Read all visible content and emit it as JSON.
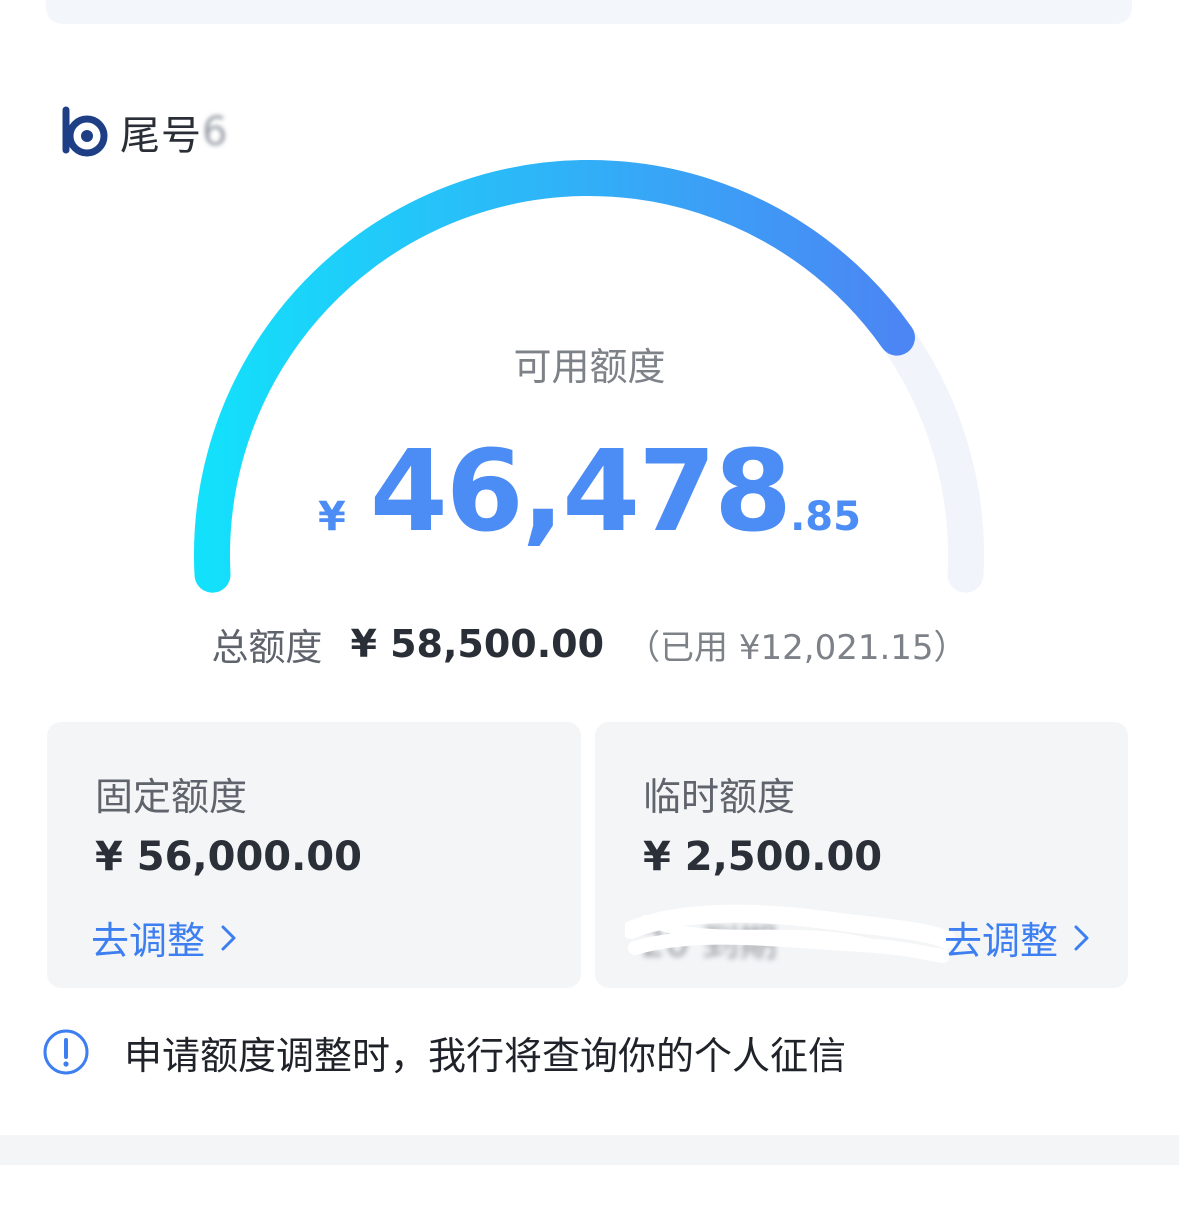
{
  "card": {
    "label": "尾号",
    "tail_visible": "6",
    "logo": "bank-logo-icon"
  },
  "credit": {
    "available_label": "可用额度",
    "available_currency": "¥",
    "available_integer": "46,478",
    "available_decimal": ".85",
    "used_fraction": 0.7945,
    "total_label": "总额度",
    "total_amount": "¥ 58,500.00",
    "used_text": "（已用 ¥12,021.15）"
  },
  "fixed": {
    "title": "固定额度",
    "amount": "¥ 56,000.00",
    "adjust": "去调整"
  },
  "temporary": {
    "title": "临时额度",
    "amount": "¥ 2,500.00",
    "expiry_text": "20 到期",
    "adjust": "去调整"
  },
  "notice": {
    "icon": "info-icon",
    "text": "申请额度调整时，我行将查询你的个人征信"
  },
  "colors": {
    "accent": "#4c8cf5",
    "gauge_start": "#13e0fb",
    "gauge_end": "#4b86f4",
    "gauge_track": "#f1f4fb",
    "link": "#3d7ef0"
  }
}
